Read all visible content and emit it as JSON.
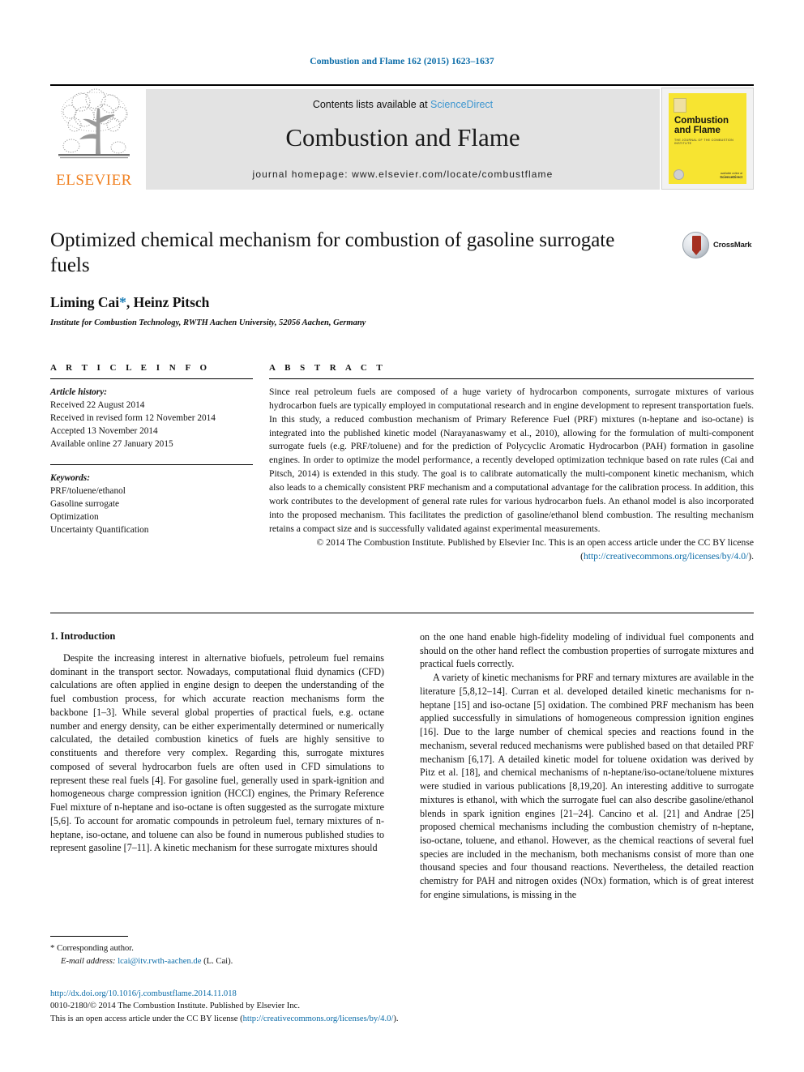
{
  "running_head": "Combustion and Flame 162 (2015) 1623–1637",
  "masthead": {
    "contents_prefix": "Contents lists available at ",
    "sciencedirect": "ScienceDirect",
    "journal_title": "Combustion and Flame",
    "homepage": "journal homepage: www.elsevier.com/locate/combustflame",
    "publisher_wordmark": "ELSEVIER",
    "cover": {
      "title": "Combustion and Flame",
      "subtitle": "THE JOURNAL OF THE COMBUSTION INSTITUTE",
      "footer_top": "available online at",
      "footer_bottom": "ScienceDirect"
    }
  },
  "article": {
    "title": "Optimized chemical mechanism for combustion of gasoline surrogate fuels",
    "authors": "Liming Cai",
    "authors_rest": ", Heinz Pitsch",
    "corresponding_marker": "*",
    "affiliation": "Institute for Combustion Technology, RWTH Aachen University, 52056 Aachen, Germany",
    "crossmark_label": "CrossMark"
  },
  "info": {
    "heading": "A R T I C L E   I N F O",
    "history_label": "Article history:",
    "history": [
      "Received 22 August 2014",
      "Received in revised form 12 November 2014",
      "Accepted 13 November 2014",
      "Available online 27 January 2015"
    ],
    "keywords_label": "Keywords:",
    "keywords": [
      "PRF/toluene/ethanol",
      "Gasoline surrogate",
      "Optimization",
      "Uncertainty Quantification"
    ]
  },
  "abstract": {
    "heading": "A B S T R A C T",
    "body": "Since real petroleum fuels are composed of a huge variety of hydrocarbon components, surrogate mixtures of various hydrocarbon fuels are typically employed in computational research and in engine development to represent transportation fuels. In this study, a reduced combustion mechanism of Primary Reference Fuel (PRF) mixtures (n-heptane and iso-octane) is integrated into the published kinetic model (Narayanaswamy et al., 2010), allowing for the formulation of multi-component surrogate fuels (e.g. PRF/toluene) and for the prediction of Polycyclic Aromatic Hydrocarbon (PAH) formation in gasoline engines. In order to optimize the model performance, a recently developed optimization technique based on rate rules (Cai and Pitsch, 2014) is extended in this study. The goal is to calibrate automatically the multi-component kinetic mechanism, which also leads to a chemically consistent PRF mechanism and a computational advantage for the calibration process. In addition, this work contributes to the development of general rate rules for various hydrocarbon fuels. An ethanol model is also incorporated into the proposed mechanism. This facilitates the prediction of gasoline/ethanol blend combustion. The resulting mechanism retains a compact size and is successfully validated against experimental measurements.",
    "copyright_text": "© 2014 The Combustion Institute. Published by Elsevier Inc. This is an open access article under the CC BY license (",
    "copyright_link": "http://creativecommons.org/licenses/by/4.0/",
    "copyright_tail": ")."
  },
  "body": {
    "section_heading": "1. Introduction",
    "left_paragraphs": [
      "Despite the increasing interest in alternative biofuels, petroleum fuel remains dominant in the transport sector. Nowadays, computational fluid dynamics (CFD) calculations are often applied in engine design to deepen the understanding of the fuel combustion process, for which accurate reaction mechanisms form the backbone [1–3]. While several global properties of practical fuels, e.g. octane number and energy density, can be either experimentally determined or numerically calculated, the detailed combustion kinetics of fuels are highly sensitive to constituents and therefore very complex. Regarding this, surrogate mixtures composed of several hydrocarbon fuels are often used in CFD simulations to represent these real fuels [4]. For gasoline fuel, generally used in spark-ignition and homogeneous charge compression ignition (HCCI) engines, the Primary Reference Fuel mixture of n-heptane and iso-octane is often suggested as the surrogate mixture [5,6]. To account for aromatic compounds in petroleum fuel, ternary mixtures of n-heptane, iso-octane, and toluene can also be found in numerous published studies to represent gasoline [7–11]. A kinetic mechanism for these surrogate mixtures should"
    ],
    "right_paragraphs": [
      "on the one hand enable high-fidelity modeling of individual fuel components and should on the other hand reflect the combustion properties of surrogate mixtures and practical fuels correctly.",
      "A variety of kinetic mechanisms for PRF and ternary mixtures are available in the literature [5,8,12–14]. Curran et al. developed detailed kinetic mechanisms for n-heptane [15] and iso-octane [5] oxidation. The combined PRF mechanism has been applied successfully in simulations of homogeneous compression ignition engines [16]. Due to the large number of chemical species and reactions found in the mechanism, several reduced mechanisms were published based on that detailed PRF mechanism [6,17]. A detailed kinetic model for toluene oxidation was derived by Pitz et al. [18], and chemical mechanisms of n-heptane/iso-octane/toluene mixtures were studied in various publications [8,19,20]. An interesting additive to surrogate mixtures is ethanol, with which the surrogate fuel can also describe gasoline/ethanol blends in spark ignition engines [21–24]. Cancino et al. [21] and Andrae [25] proposed chemical mechanisms including the combustion chemistry of n-heptane, iso-octane, toluene, and ethanol. However, as the chemical reactions of several fuel species are included in the mechanism, both mechanisms consist of more than one thousand species and four thousand reactions. Nevertheless, the detailed reaction chemistry for PAH and nitrogen oxides (NOx) formation, which is of great interest for engine simulations, is missing in the"
    ]
  },
  "footnotes": {
    "corresponding_star": "*",
    "corresponding_text": "Corresponding author.",
    "email_label": "E-mail address:",
    "email": "lcai@itv.rwth-aachen.de",
    "email_owner": "(L. Cai)."
  },
  "colophon": {
    "doi": "http://dx.doi.org/10.1016/j.combustflame.2014.11.018",
    "issn_line": "0010-2180/© 2014 The Combustion Institute. Published by Elsevier Inc.",
    "license_prefix": "This is an open access article under the CC BY license (",
    "license_link": "http://creativecommons.org/licenses/by/4.0/",
    "license_tail": ")."
  },
  "colors": {
    "link_blue": "#0b6ca8",
    "sciencedirect_blue": "#3d96d0",
    "elsevier_orange": "#f08020",
    "cover_yellow": "#f7e431",
    "banner_gray": "#e3e3e3"
  }
}
